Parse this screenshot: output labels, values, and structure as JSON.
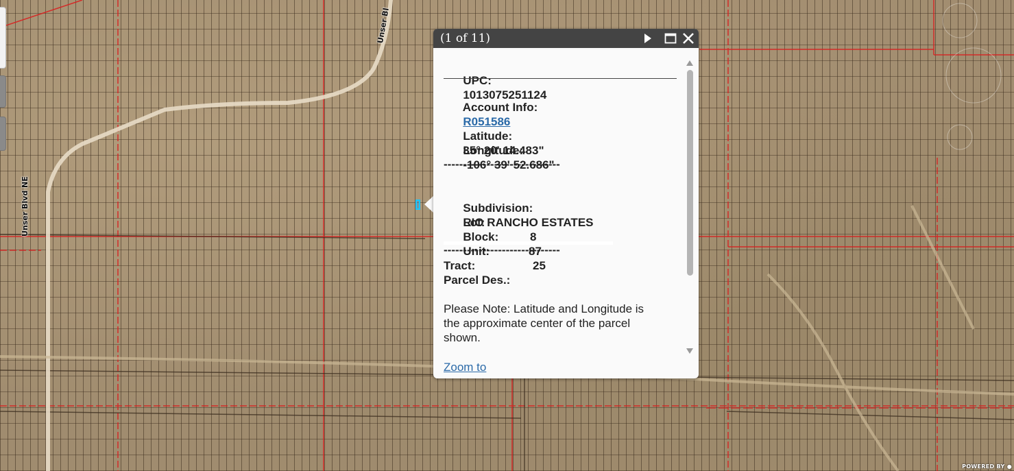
{
  "map": {
    "road_labels": [
      "Unser Blvd NE",
      "Unser Bl"
    ],
    "attribution": "POWERED BY"
  },
  "popup": {
    "counter": "(1 of 11)",
    "icons": {
      "next": "play-icon",
      "maximize": "maximize-icon",
      "close": "close-icon"
    },
    "upc_label": "UPC:",
    "upc_value": "1013075251124",
    "account_label": "Account Info:",
    "account_value": "R051586",
    "latitude_label": "Latitude:",
    "latitude_value": "35° 20' 14.483\"",
    "longitude_label": "Longitude:",
    "longitude_value": "-106° 39' 52.686\"",
    "separator": "------------------------------",
    "subdivision_label": "Subdivision:",
    "subdivision_value": "RIO RANCHO ESTATES",
    "lot_label": "Lot:",
    "lot_value": "8",
    "block_label": "Block:",
    "block_value": "87",
    "unit_label": "Unit:",
    "unit_value": "25",
    "tract_label": "Tract:",
    "parcel_des_label": "Parcel Des.:",
    "note_line1": "Please Note: Latitude and Longitude is",
    "note_line2": "the approximate center of the parcel",
    "note_line3": "shown.",
    "zoom_link": "Zoom to"
  },
  "colors": {
    "header_bg": "#444444",
    "link": "#2b6aa8",
    "parcel_highlight": "#19c6ff",
    "boundary_red": "#e02020"
  }
}
